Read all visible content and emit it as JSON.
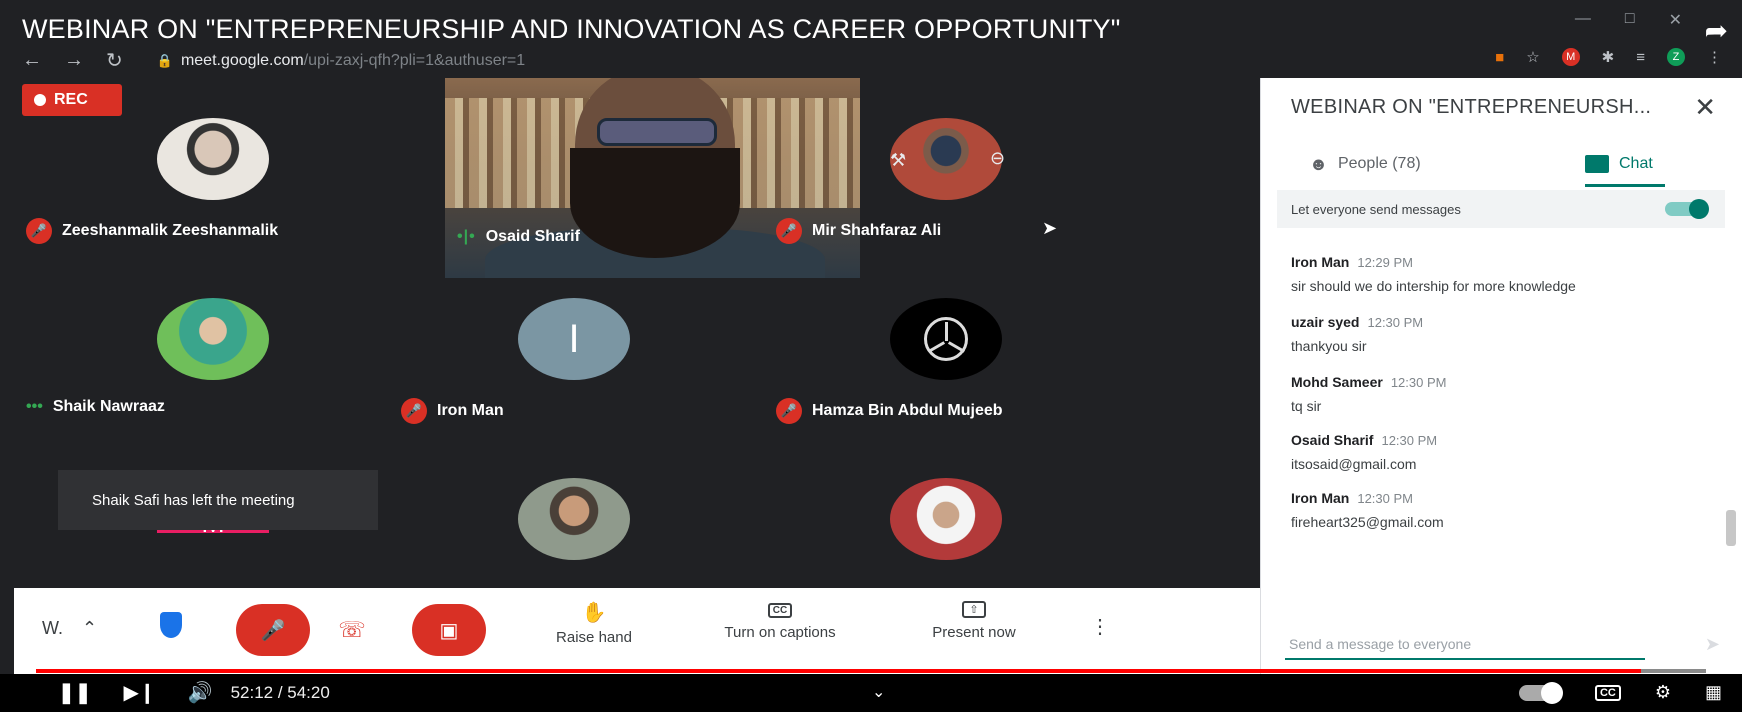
{
  "window": {
    "title": "WEBINAR ON \"ENTREPRENEURSHIP AND INNOVATION AS CAREER OPPORTUNITY\"",
    "url_host": "meet.google.com",
    "url_path": "/upi-zaxj-qfh?pli=1&authuser=1",
    "profile_initial": "Z",
    "ext_m": "M"
  },
  "meeting": {
    "rec_label": "REC",
    "participants": [
      {
        "name": "Zeeshanmalik Zeeshanmalik",
        "state": "muted"
      },
      {
        "name": "Osaid Sharif",
        "state": "speaking"
      },
      {
        "name": "Mir Shahfaraz Ali",
        "state": "muted"
      },
      {
        "name": "Shaik Nawraaz",
        "state": "active"
      },
      {
        "name": "Iron Man",
        "state": "muted",
        "avatar_letter": "I"
      },
      {
        "name": "Hamza Bin Abdul Mujeeb",
        "state": "muted"
      }
    ],
    "partial_tile_letter": "M",
    "toast": "Shaik Safi has left the meeting"
  },
  "controls": {
    "meeting_short": "W.",
    "raise_hand": "Raise hand",
    "captions": "Turn on captions",
    "present": "Present now"
  },
  "panel": {
    "title": "WEBINAR ON \"ENTREPRENEURSH...",
    "tab_people": "People (78)",
    "tab_chat": "Chat",
    "toggle_label": "Let everyone send messages",
    "messages": [
      {
        "sender": "Iron Man",
        "time": "12:29 PM",
        "body": "sir should we do intership for more knowledge"
      },
      {
        "sender": "uzair syed",
        "time": "12:30 PM",
        "body": "thankyou sir"
      },
      {
        "sender": "Mohd Sameer",
        "time": "12:30 PM",
        "body": "tq sir"
      },
      {
        "sender": "Osaid Sharif",
        "time": "12:30 PM",
        "body": "itsosaid@gmail.com"
      },
      {
        "sender": "Iron Man",
        "time": "12:30 PM",
        "body": "fireheart325@gmail.com"
      }
    ],
    "input_placeholder": "Send a message to everyone"
  },
  "player": {
    "time": "52:12 / 54:20",
    "progress": 0.961
  },
  "colors": {
    "accent": "#00796b",
    "danger": "#d93025",
    "meet_bg": "#202124"
  }
}
